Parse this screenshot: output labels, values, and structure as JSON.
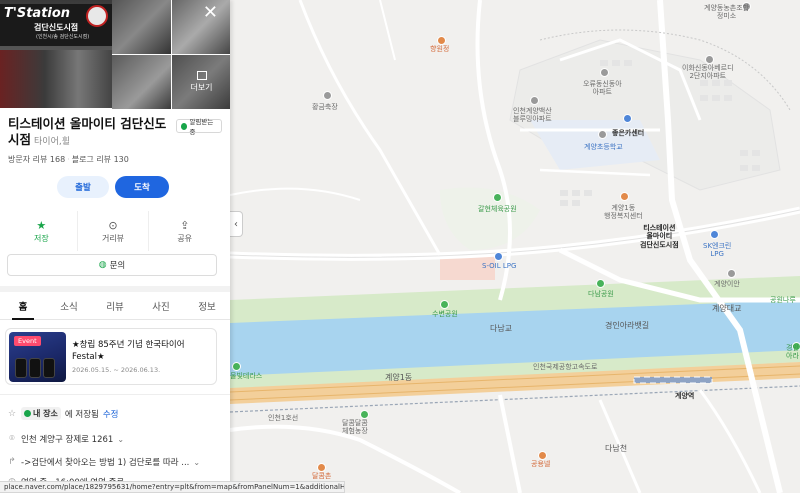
{
  "panel": {
    "photo_sign_text": "T'Station",
    "photo_sign_sub": "검단신도시점",
    "photo_sign_sub2": "(인천시/송 검단신도시점)",
    "more_photos_label": "더보기",
    "close_label": "✕",
    "place_name_line1": "티스테이션 올마이티 검단신도",
    "place_name_line2": "시점",
    "place_category": "타이어,휠",
    "badge_label": "알림받는중",
    "visitor_reviews": "방문자 리뷰 168",
    "blog_reviews": "블로그 리뷰 130",
    "separator": "·",
    "btn_start": "출발",
    "btn_arrive": "도착",
    "actions": [
      {
        "label": "저장",
        "icon": "star-icon"
      },
      {
        "label": "거리뷰",
        "icon": "location-icon"
      },
      {
        "label": "공유",
        "icon": "share-icon"
      }
    ],
    "ask_label": "문의",
    "tabs": [
      "홈",
      "소식",
      "리뷰",
      "사진",
      "정보"
    ],
    "event": {
      "badge": "Event",
      "title": "★창립 85주년 기념 한국타이어 Festal★",
      "date": "2026.05.15. ~ 2026.06.13."
    },
    "save_row": {
      "chip": "내 장소",
      "text": "에 저장됨",
      "edit": "수정"
    },
    "address": "인천 계양구 장제로 1261",
    "directions": "->검단에서 찾아오는 방법 1) 검단로를 따라 ...",
    "hours": "영업 중 · 16:00에 영업 종료",
    "status_url": "place.naver.com/place/1829795631/home?entry=plt&from=map&fromPanelNum=1&additionalHei..."
  },
  "map": {
    "labels": {
      "parking_top": "계양동농촌조합\n정미소",
      "hyangwonjeong": "향원정",
      "hwanggeum": "황금축장",
      "apt1": "오류동신동아\n아파트",
      "apt2": "이화신동아베르디\n2단지아파트",
      "apt3": "인천계양백산\n블루밍아파트",
      "center1": "좋은카센터",
      "school": "계양초등학교",
      "park1": "갈현체육공원",
      "office": "계양1동\n행정복지센터",
      "pin": "티스테이션\n올마이티\n검단신도시점",
      "sk": "SK엔크린\nLPG",
      "soil": "S-OIL LPG",
      "apt4": "계양이안",
      "park2": "다남공원",
      "sujeon": "수변공원",
      "danam_bridge": "다남교",
      "ara": "경인아라뱃길",
      "gyeyang_bridge": "계양대교",
      "gyeyang1": "계양1동",
      "airport_rail": "인천국제공항고속도로",
      "station": "계양역",
      "park3": "공원나루",
      "terrace": "물빛테라스",
      "farm": "달콤달콤\n체험농장",
      "dalam": "달콤촌",
      "gongyong": "공용넬",
      "danamcheon": "다남천",
      "road_a": "인천1호선",
      "right_edge": "경인\n아라"
    }
  }
}
